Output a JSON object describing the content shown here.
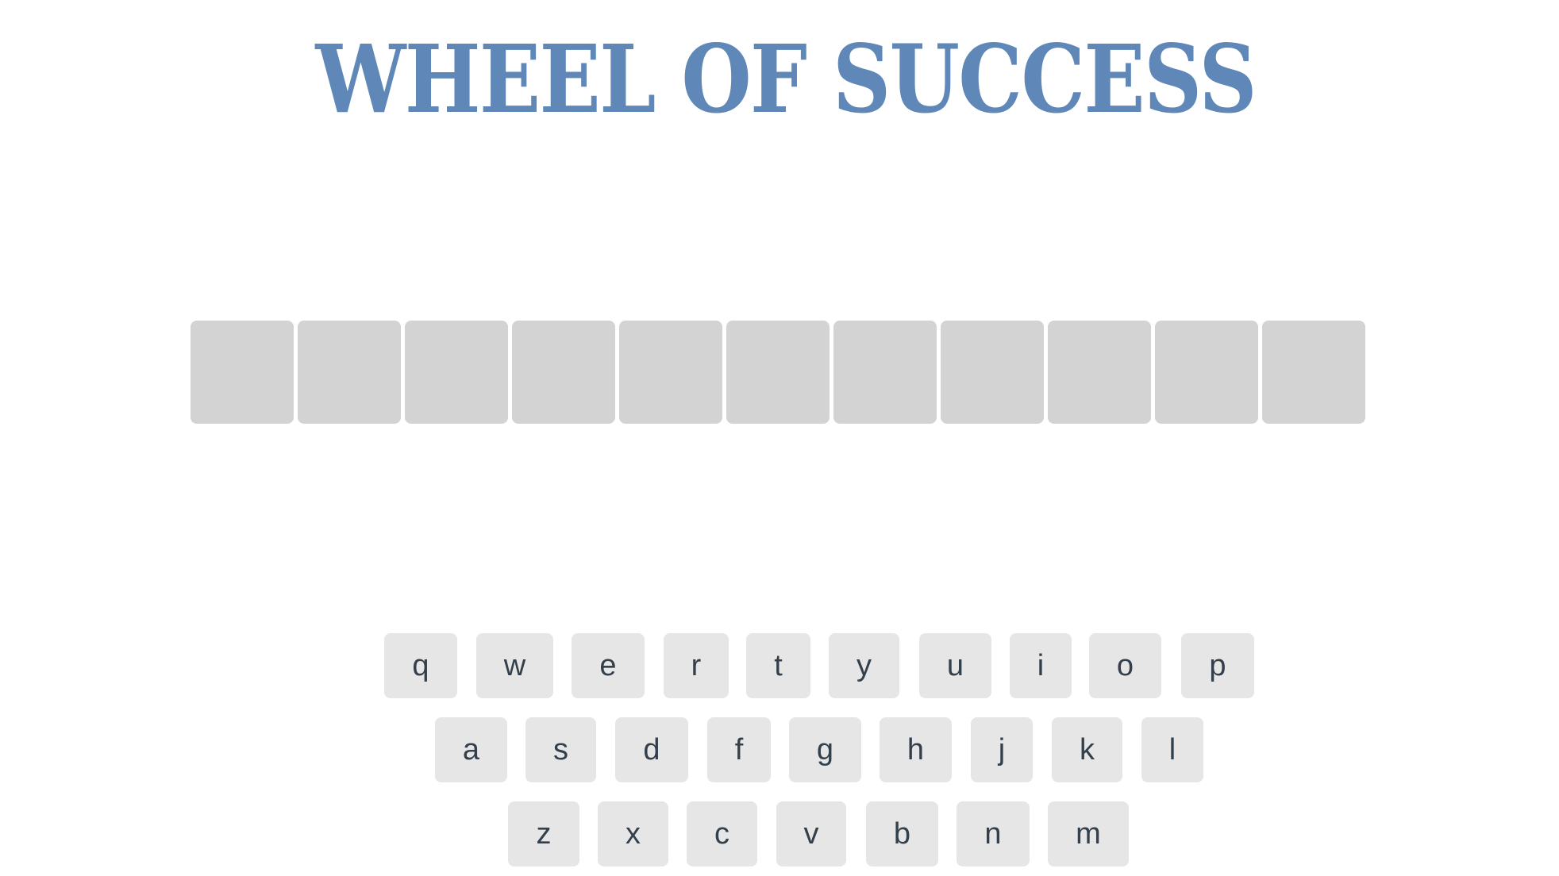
{
  "title": "WHEEL OF SUCCESS",
  "colors": {
    "title": "#5f88b8",
    "tile": "#d3d3d3",
    "key_bg": "#e6e6e6",
    "key_text": "#333f4a"
  },
  "board": {
    "tile_count": 11
  },
  "keyboard": {
    "rows": [
      [
        "q",
        "w",
        "e",
        "r",
        "t",
        "y",
        "u",
        "i",
        "o",
        "p"
      ],
      [
        "a",
        "s",
        "d",
        "f",
        "g",
        "h",
        "j",
        "k",
        "l"
      ],
      [
        "z",
        "x",
        "c",
        "v",
        "b",
        "n",
        "m"
      ]
    ]
  }
}
